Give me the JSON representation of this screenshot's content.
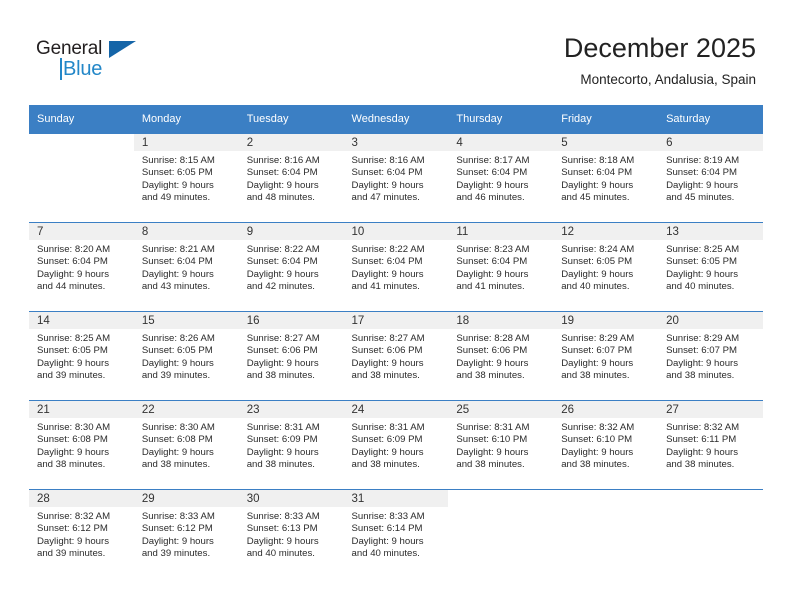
{
  "brand": {
    "name_part1": "General",
    "name_part2": "Blue",
    "triangle_icon": "blue-triangle-logo-mark",
    "accent_blue": "#2387c8",
    "dark_text": "#231f20"
  },
  "header": {
    "title": "December 2025",
    "subtitle": "Montecorto, Andalusia, Spain"
  },
  "theme": {
    "header_row_bg": "#3b7fc4",
    "daynum_bg": "#f0f0f0",
    "week_border": "#3b7fc4"
  },
  "weekdays": [
    "Sunday",
    "Monday",
    "Tuesday",
    "Wednesday",
    "Thursday",
    "Friday",
    "Saturday"
  ],
  "weeks": [
    [
      {
        "day": "",
        "sunrise": "",
        "sunset": "",
        "daylight1": "",
        "daylight2": ""
      },
      {
        "day": "1",
        "sunrise": "Sunrise: 8:15 AM",
        "sunset": "Sunset: 6:05 PM",
        "daylight1": "Daylight: 9 hours",
        "daylight2": "and 49 minutes."
      },
      {
        "day": "2",
        "sunrise": "Sunrise: 8:16 AM",
        "sunset": "Sunset: 6:04 PM",
        "daylight1": "Daylight: 9 hours",
        "daylight2": "and 48 minutes."
      },
      {
        "day": "3",
        "sunrise": "Sunrise: 8:16 AM",
        "sunset": "Sunset: 6:04 PM",
        "daylight1": "Daylight: 9 hours",
        "daylight2": "and 47 minutes."
      },
      {
        "day": "4",
        "sunrise": "Sunrise: 8:17 AM",
        "sunset": "Sunset: 6:04 PM",
        "daylight1": "Daylight: 9 hours",
        "daylight2": "and 46 minutes."
      },
      {
        "day": "5",
        "sunrise": "Sunrise: 8:18 AM",
        "sunset": "Sunset: 6:04 PM",
        "daylight1": "Daylight: 9 hours",
        "daylight2": "and 45 minutes."
      },
      {
        "day": "6",
        "sunrise": "Sunrise: 8:19 AM",
        "sunset": "Sunset: 6:04 PM",
        "daylight1": "Daylight: 9 hours",
        "daylight2": "and 45 minutes."
      }
    ],
    [
      {
        "day": "7",
        "sunrise": "Sunrise: 8:20 AM",
        "sunset": "Sunset: 6:04 PM",
        "daylight1": "Daylight: 9 hours",
        "daylight2": "and 44 minutes."
      },
      {
        "day": "8",
        "sunrise": "Sunrise: 8:21 AM",
        "sunset": "Sunset: 6:04 PM",
        "daylight1": "Daylight: 9 hours",
        "daylight2": "and 43 minutes."
      },
      {
        "day": "9",
        "sunrise": "Sunrise: 8:22 AM",
        "sunset": "Sunset: 6:04 PM",
        "daylight1": "Daylight: 9 hours",
        "daylight2": "and 42 minutes."
      },
      {
        "day": "10",
        "sunrise": "Sunrise: 8:22 AM",
        "sunset": "Sunset: 6:04 PM",
        "daylight1": "Daylight: 9 hours",
        "daylight2": "and 41 minutes."
      },
      {
        "day": "11",
        "sunrise": "Sunrise: 8:23 AM",
        "sunset": "Sunset: 6:04 PM",
        "daylight1": "Daylight: 9 hours",
        "daylight2": "and 41 minutes."
      },
      {
        "day": "12",
        "sunrise": "Sunrise: 8:24 AM",
        "sunset": "Sunset: 6:05 PM",
        "daylight1": "Daylight: 9 hours",
        "daylight2": "and 40 minutes."
      },
      {
        "day": "13",
        "sunrise": "Sunrise: 8:25 AM",
        "sunset": "Sunset: 6:05 PM",
        "daylight1": "Daylight: 9 hours",
        "daylight2": "and 40 minutes."
      }
    ],
    [
      {
        "day": "14",
        "sunrise": "Sunrise: 8:25 AM",
        "sunset": "Sunset: 6:05 PM",
        "daylight1": "Daylight: 9 hours",
        "daylight2": "and 39 minutes."
      },
      {
        "day": "15",
        "sunrise": "Sunrise: 8:26 AM",
        "sunset": "Sunset: 6:05 PM",
        "daylight1": "Daylight: 9 hours",
        "daylight2": "and 39 minutes."
      },
      {
        "day": "16",
        "sunrise": "Sunrise: 8:27 AM",
        "sunset": "Sunset: 6:06 PM",
        "daylight1": "Daylight: 9 hours",
        "daylight2": "and 38 minutes."
      },
      {
        "day": "17",
        "sunrise": "Sunrise: 8:27 AM",
        "sunset": "Sunset: 6:06 PM",
        "daylight1": "Daylight: 9 hours",
        "daylight2": "and 38 minutes."
      },
      {
        "day": "18",
        "sunrise": "Sunrise: 8:28 AM",
        "sunset": "Sunset: 6:06 PM",
        "daylight1": "Daylight: 9 hours",
        "daylight2": "and 38 minutes."
      },
      {
        "day": "19",
        "sunrise": "Sunrise: 8:29 AM",
        "sunset": "Sunset: 6:07 PM",
        "daylight1": "Daylight: 9 hours",
        "daylight2": "and 38 minutes."
      },
      {
        "day": "20",
        "sunrise": "Sunrise: 8:29 AM",
        "sunset": "Sunset: 6:07 PM",
        "daylight1": "Daylight: 9 hours",
        "daylight2": "and 38 minutes."
      }
    ],
    [
      {
        "day": "21",
        "sunrise": "Sunrise: 8:30 AM",
        "sunset": "Sunset: 6:08 PM",
        "daylight1": "Daylight: 9 hours",
        "daylight2": "and 38 minutes."
      },
      {
        "day": "22",
        "sunrise": "Sunrise: 8:30 AM",
        "sunset": "Sunset: 6:08 PM",
        "daylight1": "Daylight: 9 hours",
        "daylight2": "and 38 minutes."
      },
      {
        "day": "23",
        "sunrise": "Sunrise: 8:31 AM",
        "sunset": "Sunset: 6:09 PM",
        "daylight1": "Daylight: 9 hours",
        "daylight2": "and 38 minutes."
      },
      {
        "day": "24",
        "sunrise": "Sunrise: 8:31 AM",
        "sunset": "Sunset: 6:09 PM",
        "daylight1": "Daylight: 9 hours",
        "daylight2": "and 38 minutes."
      },
      {
        "day": "25",
        "sunrise": "Sunrise: 8:31 AM",
        "sunset": "Sunset: 6:10 PM",
        "daylight1": "Daylight: 9 hours",
        "daylight2": "and 38 minutes."
      },
      {
        "day": "26",
        "sunrise": "Sunrise: 8:32 AM",
        "sunset": "Sunset: 6:10 PM",
        "daylight1": "Daylight: 9 hours",
        "daylight2": "and 38 minutes."
      },
      {
        "day": "27",
        "sunrise": "Sunrise: 8:32 AM",
        "sunset": "Sunset: 6:11 PM",
        "daylight1": "Daylight: 9 hours",
        "daylight2": "and 38 minutes."
      }
    ],
    [
      {
        "day": "28",
        "sunrise": "Sunrise: 8:32 AM",
        "sunset": "Sunset: 6:12 PM",
        "daylight1": "Daylight: 9 hours",
        "daylight2": "and 39 minutes."
      },
      {
        "day": "29",
        "sunrise": "Sunrise: 8:33 AM",
        "sunset": "Sunset: 6:12 PM",
        "daylight1": "Daylight: 9 hours",
        "daylight2": "and 39 minutes."
      },
      {
        "day": "30",
        "sunrise": "Sunrise: 8:33 AM",
        "sunset": "Sunset: 6:13 PM",
        "daylight1": "Daylight: 9 hours",
        "daylight2": "and 40 minutes."
      },
      {
        "day": "31",
        "sunrise": "Sunrise: 8:33 AM",
        "sunset": "Sunset: 6:14 PM",
        "daylight1": "Daylight: 9 hours",
        "daylight2": "and 40 minutes."
      },
      {
        "day": "",
        "sunrise": "",
        "sunset": "",
        "daylight1": "",
        "daylight2": ""
      },
      {
        "day": "",
        "sunrise": "",
        "sunset": "",
        "daylight1": "",
        "daylight2": ""
      },
      {
        "day": "",
        "sunrise": "",
        "sunset": "",
        "daylight1": "",
        "daylight2": ""
      }
    ]
  ]
}
